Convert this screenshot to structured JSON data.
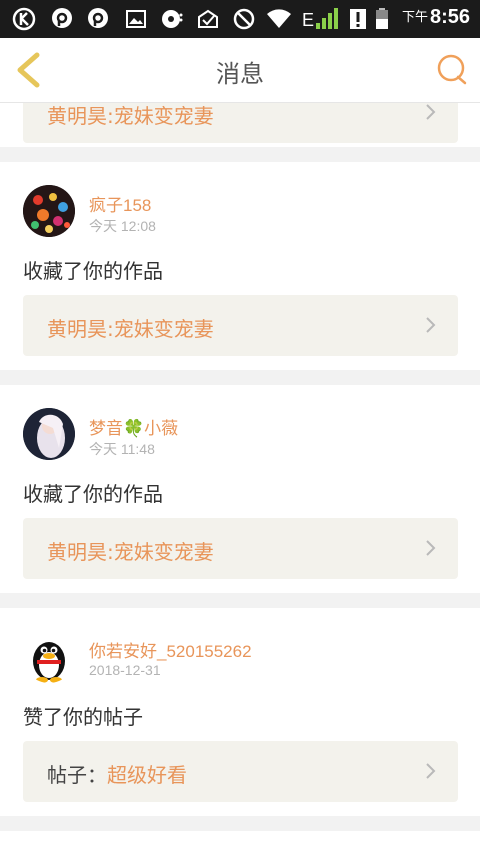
{
  "status_bar": {
    "time_prefix": "下午",
    "time": "8:56",
    "network": "E",
    "icons": [
      "k-app-icon",
      "chat-bubble-icon",
      "chat-bubble-icon",
      "image-icon",
      "media-icon",
      "signal-off-icon",
      "block-icon",
      "wifi-icon",
      "cell-signal-icon",
      "alert-icon",
      "battery-icon"
    ]
  },
  "header": {
    "title": "消息",
    "back_icon": "chevron-left-icon",
    "search_icon": "search-icon",
    "accent": "#e6c65a",
    "search_color": "#f0a05a"
  },
  "messages": [
    {
      "ref_title": "黄明昊:宠妹变宠妻"
    },
    {
      "user": "疯子158",
      "time": "今天 12:08",
      "action": "收藏了你的作品",
      "ref_title": "黄明昊:宠妹变宠妻"
    },
    {
      "user": "梦音🍀小薇",
      "time": "今天 11:48",
      "action": "收藏了你的作品",
      "ref_title": "黄明昊:宠妹变宠妻"
    },
    {
      "user": "你若安好_520155262",
      "time": "2018-12-31",
      "action": "赞了你的帖子",
      "ref_label": "帖子：",
      "ref_title": "超级好看"
    }
  ],
  "colors": {
    "username": "#e8955a",
    "background": "#f2f2f2",
    "ref_background": "#f3f2ec"
  }
}
